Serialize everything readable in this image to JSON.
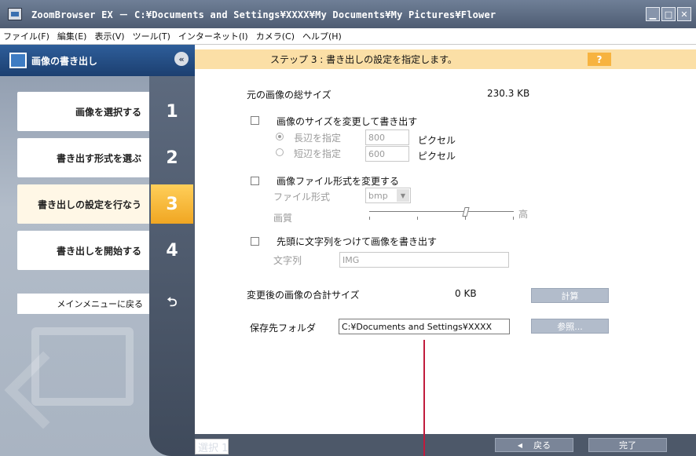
{
  "window": {
    "title": "ZoomBrowser EX － C:¥Documents and Settings¥XXXX¥My Documents¥My Pictures¥Flower",
    "buttons": [
      "minimize",
      "maximize",
      "close"
    ]
  },
  "menu": [
    "ファイル(F)",
    "編集(E)",
    "表示(V)",
    "ツール(T)",
    "インターネット(I)",
    "カメラ(C)",
    "ヘルプ(H)"
  ],
  "sidebar": {
    "title": "画像の書き出し",
    "steps": [
      {
        "label": "画像を選択する",
        "num": "1"
      },
      {
        "label": "書き出す形式を選ぶ",
        "num": "2"
      },
      {
        "label": "書き出しの設定を行なう",
        "num": "3"
      },
      {
        "label": "書き出しを開始する",
        "num": "4"
      }
    ],
    "back_label": "メインメニューに戻る",
    "back_icon": "return-arrow-icon"
  },
  "step_bar": {
    "text": "ステップ 3 : 書き出しの設定を指定します。",
    "help": "?"
  },
  "settings": {
    "original_total_label": "元の画像の総サイズ",
    "original_total_value": "230.3 KB",
    "resize_label": "画像のサイズを変更して書き出す",
    "long_side_label": "長辺を指定",
    "long_side_value": "800",
    "short_side_label": "短辺を指定",
    "short_side_value": "600",
    "pixel_unit": "ピクセル",
    "format_change_label": "画像ファイル形式を変更する",
    "file_format_label": "ファイル形式",
    "file_format_value": "bmp",
    "quality_label": "画質",
    "quality_high": "高",
    "quality_level": 0.65,
    "prefix_label": "先頭に文字列をつけて画像を書き出す",
    "string_label": "文字列",
    "string_value": "IMG",
    "new_total_label": "変更後の画像の合計サイズ",
    "new_total_value": "0 KB",
    "calc_button": "計算",
    "save_folder_label": "保存先フォルダ",
    "save_folder_value": "C:¥Documents and Settings¥XXXX",
    "browse_button": "参照..."
  },
  "footer": {
    "selection": "選択 1",
    "back_button": "戻る",
    "finish_button": "完了"
  },
  "colors": {
    "active_step": "#f0a622",
    "step_bar": "#fbdfa6",
    "pointer_line": "#c11b3c"
  }
}
